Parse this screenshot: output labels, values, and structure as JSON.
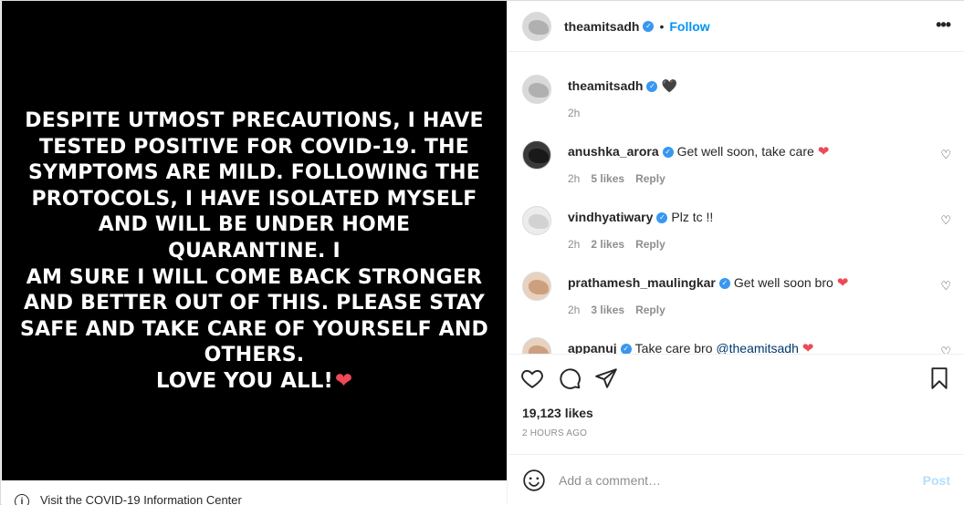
{
  "media": {
    "lines": [
      "DESPITE UTMOST PRECAUTIONS, I HAVE",
      "TESTED POSITIVE FOR COVID-19. THE",
      "SYMPTOMS ARE MILD. FOLLOWING THE",
      "PROTOCOLS, I HAVE ISOLATED MYSELF",
      "AND WILL BE UNDER HOME QUARANTINE. I",
      "AM SURE I WILL COME BACK STRONGER",
      "AND BETTER OUT OF THIS. PLEASE STAY",
      "SAFE AND TAKE CARE OF YOURSELF AND",
      "OTHERS."
    ],
    "signoff": "LOVE YOU ALL!",
    "signoff_emoji": "❤",
    "covid_link": "Visit the COVID-19 Information Center"
  },
  "header": {
    "username": "theamitsadh",
    "separator": "•",
    "follow_label": "Follow",
    "more_label": "•••"
  },
  "caption": {
    "username": "theamitsadh",
    "text": "🖤",
    "time": "2h"
  },
  "comments": [
    {
      "username": "anushka_arora",
      "text": "Get well soon, take care",
      "emoji": "❤",
      "time": "2h",
      "likes": "5 likes",
      "reply": "Reply"
    },
    {
      "username": "vindhyatiwary",
      "text": "Plz tc !!",
      "emoji": "",
      "time": "2h",
      "likes": "2 likes",
      "reply": "Reply"
    },
    {
      "username": "prathamesh_maulingkar",
      "text": "Get well soon bro",
      "emoji": "❤",
      "time": "2h",
      "likes": "3 likes",
      "reply": "Reply"
    },
    {
      "username": "appanuj",
      "text": "Take care bro",
      "mention": "@theamitsadh",
      "emoji": "❤",
      "time": "",
      "likes": "",
      "reply": ""
    }
  ],
  "actions": {
    "likes": "19,123 likes",
    "time_ago": "2 HOURS AGO"
  },
  "add_comment": {
    "placeholder": "Add a comment…",
    "post_label": "Post"
  },
  "colors": {
    "accent": "#0095f6",
    "verified": "#3897f0",
    "heart": "#ed4956",
    "muted": "#8e8e8e"
  }
}
